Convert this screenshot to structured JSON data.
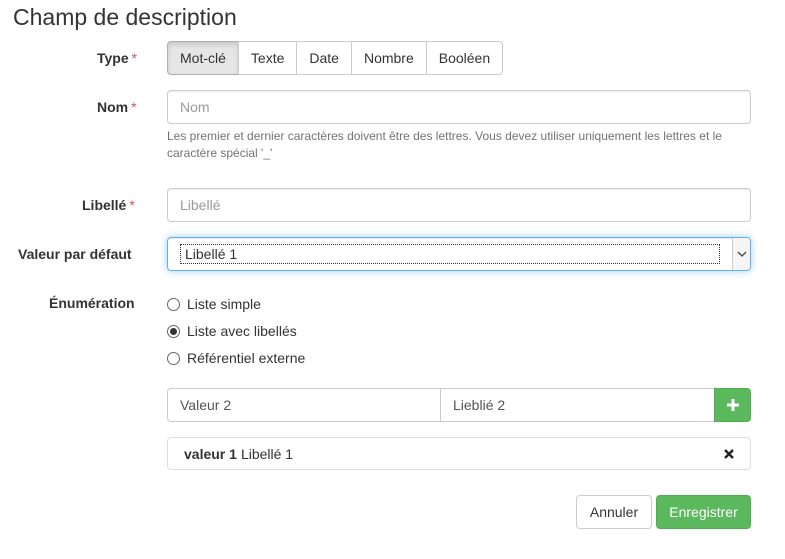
{
  "title": "Champ de description",
  "required_mark": "*",
  "type": {
    "label": "Type",
    "options": [
      "Mot-clé",
      "Texte",
      "Date",
      "Nombre",
      "Booléen"
    ],
    "selected": "Mot-clé"
  },
  "nom": {
    "label": "Nom",
    "value": "",
    "placeholder": "Nom",
    "help": "Les premier et dernier caractères doivent être des lettres. Vous devez utiliser uniquement les lettres et le caractère spécial '_'"
  },
  "libelle": {
    "label": "Libellé",
    "value": "",
    "placeholder": "Libellé"
  },
  "default_value": {
    "label": "Valeur par défaut",
    "selected": "Libellé 1"
  },
  "enumeration": {
    "label": "Énumération",
    "options": [
      "Liste simple",
      "Liste avec libellés",
      "Référentiel externe"
    ],
    "selected": "Liste avec libellés"
  },
  "new_entry": {
    "value": "Valeur 2",
    "label": "Lieblié 2"
  },
  "entries": [
    {
      "value": "valeur 1",
      "label": "Libellé 1"
    }
  ],
  "actions": {
    "cancel": "Annuler",
    "save": "Enregistrer"
  },
  "colors": {
    "success": "#5cb85c",
    "required": "#d9534f",
    "focus": "#66afe9"
  },
  "icons": {
    "add": "plus-icon",
    "remove": "close-icon",
    "dropdown": "chevron-down-icon"
  }
}
